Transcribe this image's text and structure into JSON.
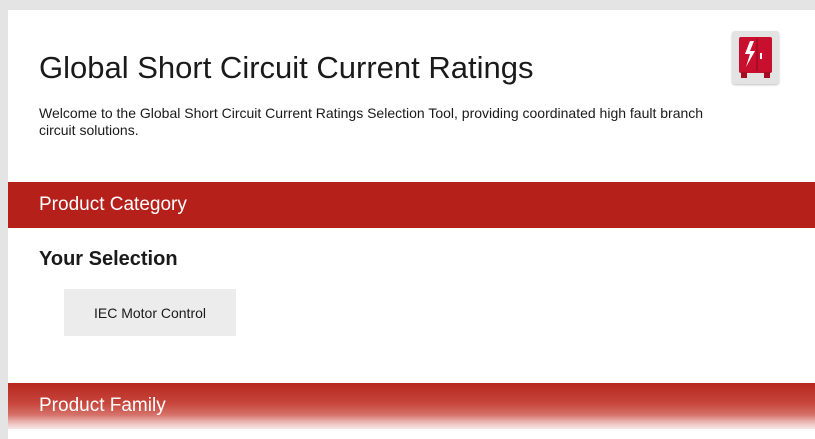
{
  "header": {
    "title": "Global Short Circuit Current Ratings",
    "subtitle": "Welcome to the Global Short Circuit Current Ratings Selection Tool, providing coordinated high fault branch circuit solutions.",
    "logo_icon": "cabinet-lightning-icon",
    "logo_color": "#c8102e"
  },
  "sections": {
    "product_category": {
      "label": "Product Category",
      "band_color": "#b5201a"
    },
    "your_selection": {
      "heading": "Your Selection",
      "selected": "IEC Motor Control"
    },
    "product_family": {
      "label": "Product Family"
    }
  }
}
